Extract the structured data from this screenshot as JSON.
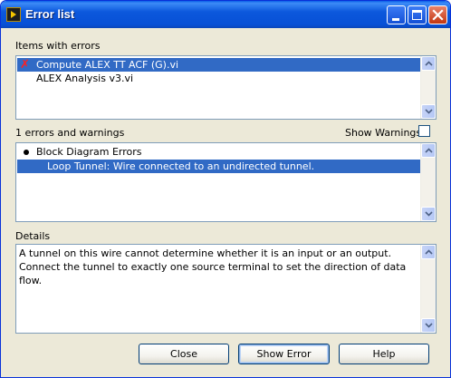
{
  "window": {
    "title": "Error list"
  },
  "items_section": {
    "label": "Items with errors",
    "items": [
      {
        "label": "Compute ALEX TT ACF (G).vi",
        "has_error": true,
        "selected": true
      },
      {
        "label": "ALEX Analysis v3.vi",
        "has_error": false,
        "selected": false
      }
    ]
  },
  "errors_section": {
    "count_label": "1 errors and warnings",
    "show_warnings_label": "Show Warnings",
    "show_warnings_checked": false,
    "items": [
      {
        "label": "Block Diagram Errors",
        "type": "group"
      },
      {
        "label": "Loop Tunnel: Wire connected to an undirected tunnel.",
        "type": "error",
        "selected": true
      }
    ]
  },
  "details_section": {
    "label": "Details",
    "text": "A tunnel on this wire cannot determine whether it is an input or an output. Connect the tunnel to exactly one source terminal to set the direction of data flow."
  },
  "buttons": {
    "close": "Close",
    "show_error": "Show Error",
    "help": "Help"
  },
  "colors": {
    "title_bar": "#0750d6",
    "selection": "#316ac5",
    "dialog_bg": "#ece9d8",
    "list_border": "#7f9db9",
    "error_mark": "#c00000"
  }
}
